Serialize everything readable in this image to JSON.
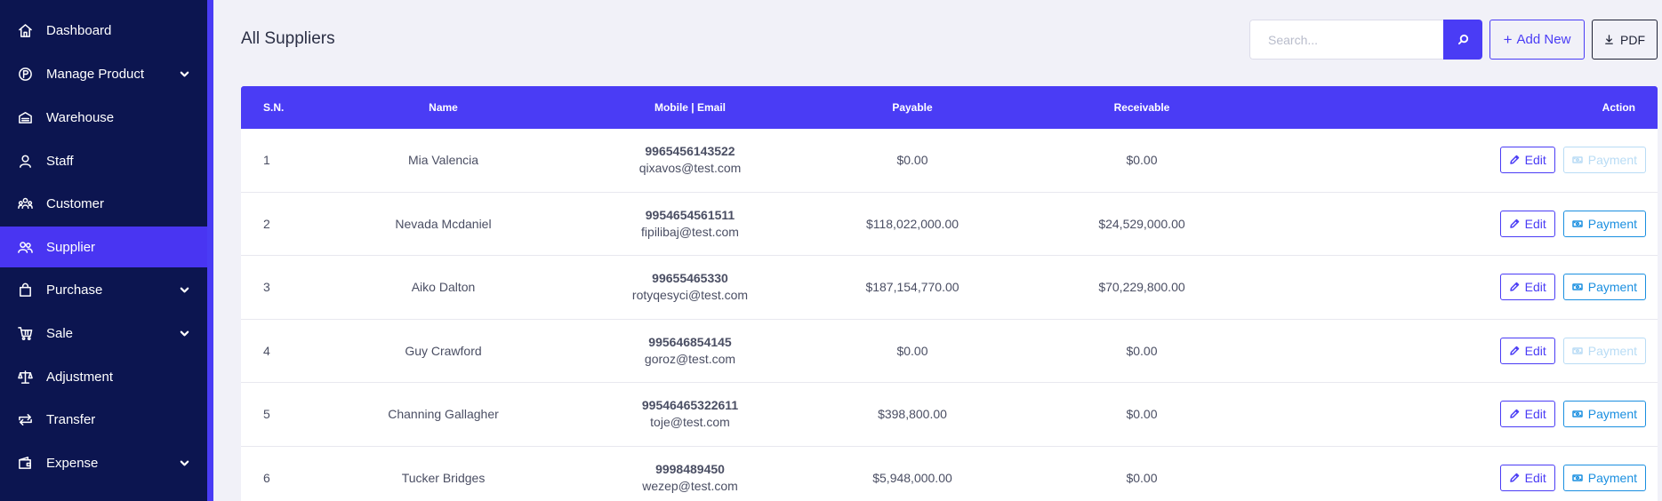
{
  "sidebar": {
    "items": [
      {
        "label": "Dashboard",
        "icon": "home-icon",
        "chevron": false,
        "active": false
      },
      {
        "label": "Manage Product",
        "icon": "product-icon",
        "chevron": true,
        "active": false
      },
      {
        "label": "Warehouse",
        "icon": "warehouse-icon",
        "chevron": false,
        "active": false
      },
      {
        "label": "Staff",
        "icon": "user-icon",
        "chevron": false,
        "active": false
      },
      {
        "label": "Customer",
        "icon": "customer-icon",
        "chevron": false,
        "active": false
      },
      {
        "label": "Supplier",
        "icon": "supplier-icon",
        "chevron": false,
        "active": true
      },
      {
        "label": "Purchase",
        "icon": "bag-icon",
        "chevron": true,
        "active": false
      },
      {
        "label": "Sale",
        "icon": "cart-icon",
        "chevron": true,
        "active": false
      },
      {
        "label": "Adjustment",
        "icon": "scale-icon",
        "chevron": false,
        "active": false
      },
      {
        "label": "Transfer",
        "icon": "transfer-icon",
        "chevron": false,
        "active": false
      },
      {
        "label": "Expense",
        "icon": "wallet-icon",
        "chevron": true,
        "active": false
      }
    ]
  },
  "header": {
    "title": "All Suppliers",
    "search_placeholder": "Search...",
    "add_label": "Add New",
    "pdf_label": "PDF"
  },
  "table": {
    "columns": {
      "sn": "S.N.",
      "name": "Name",
      "contact": "Mobile | Email",
      "payable": "Payable",
      "receivable": "Receivable",
      "action": "Action"
    },
    "edit_label": "Edit",
    "payment_label": "Payment",
    "rows": [
      {
        "sn": "1",
        "name": "Mia Valencia",
        "mobile": "9965456143522",
        "email": "qixavos@test.com",
        "payable": "$0.00",
        "receivable": "$0.00",
        "payment_enabled": false
      },
      {
        "sn": "2",
        "name": "Nevada Mcdaniel",
        "mobile": "9954654561511",
        "email": "fipilibaj@test.com",
        "payable": "$118,022,000.00",
        "receivable": "$24,529,000.00",
        "payment_enabled": true
      },
      {
        "sn": "3",
        "name": "Aiko Dalton",
        "mobile": "99655465330",
        "email": "rotyqesyci@test.com",
        "payable": "$187,154,770.00",
        "receivable": "$70,229,800.00",
        "payment_enabled": true
      },
      {
        "sn": "4",
        "name": "Guy Crawford",
        "mobile": "995646854145",
        "email": "goroz@test.com",
        "payable": "$0.00",
        "receivable": "$0.00",
        "payment_enabled": false
      },
      {
        "sn": "5",
        "name": "Channing Gallagher",
        "mobile": "99546465322611",
        "email": "toje@test.com",
        "payable": "$398,800.00",
        "receivable": "$0.00",
        "payment_enabled": true
      },
      {
        "sn": "6",
        "name": "Tucker Bridges",
        "mobile": "9998489450",
        "email": "wezep@test.com",
        "payable": "$5,948,000.00",
        "receivable": "$0.00",
        "payment_enabled": true
      }
    ]
  },
  "colors": {
    "sidebar_bg": "#0c1550",
    "accent": "#4a3cf5",
    "payment_blue": "#1a8fe0",
    "payment_disabled": "#b9dcf5"
  }
}
